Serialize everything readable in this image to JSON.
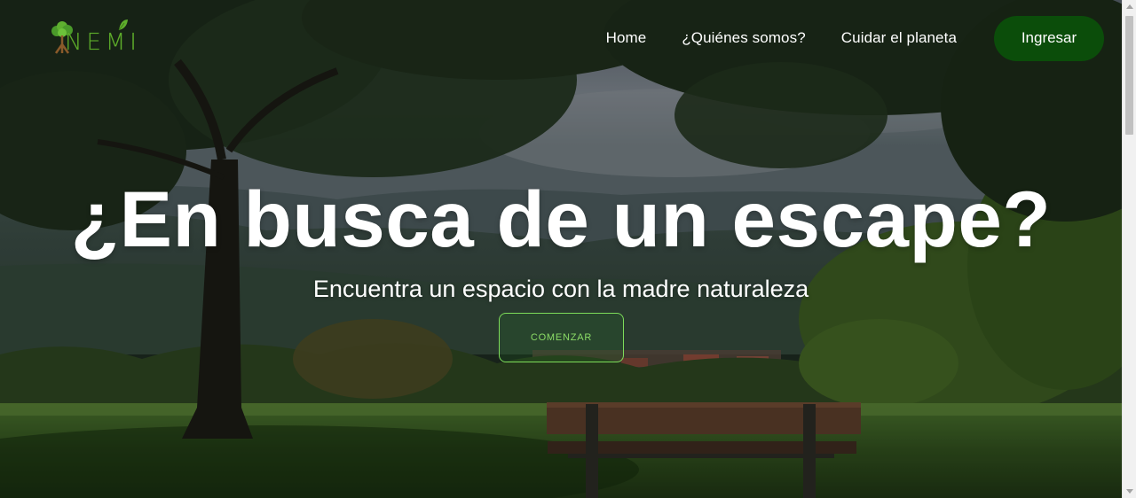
{
  "brand": {
    "logo_text": "NEMI",
    "logo_color": "#5fae2c"
  },
  "nav": {
    "links": [
      {
        "label": "Home"
      },
      {
        "label": "¿Quiénes somos?"
      },
      {
        "label": "Cuidar el planeta"
      }
    ],
    "login_label": "Ingresar",
    "login_color": "#0b4d0a"
  },
  "hero": {
    "title": "¿En busca de un escape?",
    "subtitle": "Encuentra un espacio con la madre naturaleza",
    "cta_label": "COMENZAR",
    "cta_color": "#7ddc5a",
    "background": "park-bench-under-tree-photo"
  }
}
